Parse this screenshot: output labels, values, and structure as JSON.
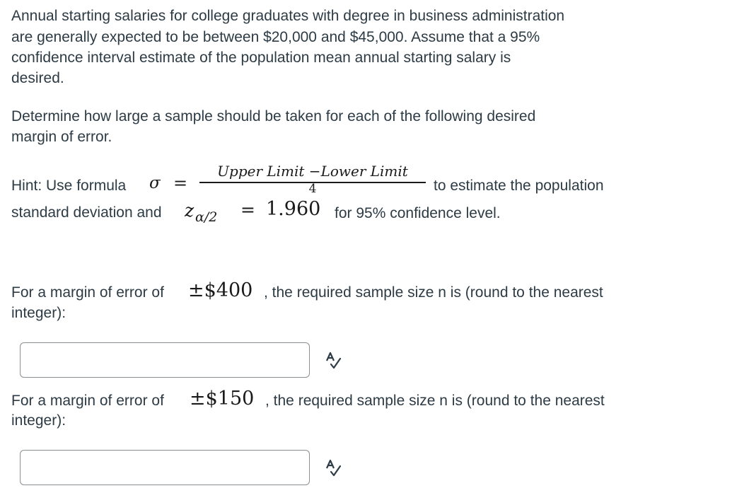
{
  "question": {
    "intro_lines": [
      "Annual starting salaries for college graduates with degree in business administration",
      "are generally expected to be between $20,000 and $45,000. Assume that a 95%",
      "confidence interval estimate of the population mean annual starting salary is",
      "desired."
    ],
    "task_lines": [
      "Determine how large a sample should be taken for each of the following desired",
      "margin of error."
    ],
    "hint": {
      "prefix": "Hint: Use formula",
      "sigma": "σ",
      "equals": "=",
      "numerator": "Upper Limit −Lower Limit",
      "denominator": "4",
      "suffix": "to estimate the population",
      "line2_prefix": "standard deviation and",
      "z_symbol": "z",
      "z_subscript": "α/2",
      "z_value": "1.960",
      "line2_suffix": "for 95% confidence level."
    }
  },
  "parts": [
    {
      "prefix": "For a margin of error of",
      "margin": "±$400",
      "suffix": ", the required sample size n is (round to the nearest",
      "line2": "integer):",
      "answer_value": "",
      "answer_placeholder": ""
    },
    {
      "prefix": "For a margin of error of",
      "margin": "±$150",
      "suffix": ", the required sample size n is (round to the nearest",
      "line2": "integer):",
      "answer_value": "",
      "answer_placeholder": ""
    }
  ],
  "icons": {
    "spellcheck": "spellcheck-icon"
  }
}
